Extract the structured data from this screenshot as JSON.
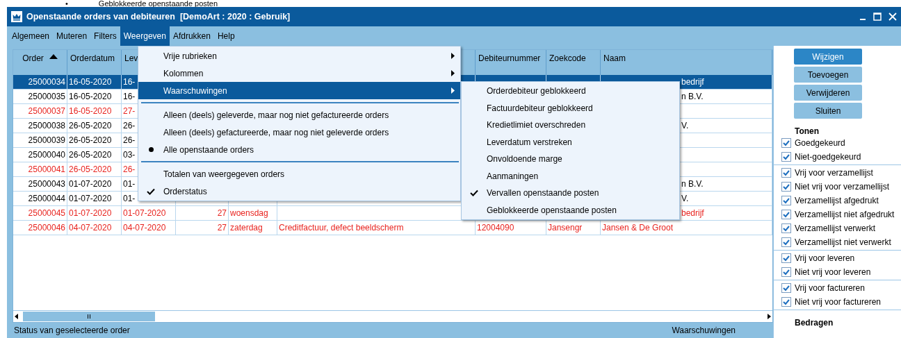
{
  "document_caption": {
    "bullet": "•",
    "text": "Geblokkeerde openstaande posten"
  },
  "window": {
    "title": "Openstaande orders van debiteuren  [DemoArt : 2020 : Gebruik]"
  },
  "menu_bar": [
    {
      "label": "Algemeen",
      "selected": false
    },
    {
      "label": "Muteren",
      "selected": false
    },
    {
      "label": "Filters",
      "selected": false
    },
    {
      "label": "Weergeven",
      "selected": true
    },
    {
      "label": "Afdrukken",
      "selected": false
    },
    {
      "label": "Help",
      "selected": false
    }
  ],
  "table": {
    "columns": {
      "order": {
        "label": "Order",
        "sorted": true
      },
      "orderdatum": {
        "label": "Orderdatum"
      },
      "column_3": {
        "label": "Lev"
      },
      "debiteurnummer": {
        "label": "Debiteurnummer"
      },
      "zoekcode": {
        "label": "Zoekcode"
      },
      "naam": {
        "label": "Naam"
      }
    },
    "rows": [
      {
        "selected": true,
        "warning": false,
        "order": "25000034",
        "orderdatum": "16-05-2020",
        "column_3": "16-",
        "naam": "bedrijf"
      },
      {
        "selected": false,
        "warning": false,
        "order": "25000035",
        "orderdatum": "16-05-2020",
        "column_3": "16-",
        "naam": "n B.V."
      },
      {
        "selected": false,
        "warning": true,
        "order": "25000037",
        "orderdatum": "16-05-2020",
        "column_3": "27-"
      },
      {
        "selected": false,
        "warning": false,
        "order": "25000038",
        "orderdatum": "26-05-2020",
        "column_3": "26-",
        "naam": "V."
      },
      {
        "selected": false,
        "warning": false,
        "order": "25000039",
        "orderdatum": "26-05-2020",
        "column_3": "26-"
      },
      {
        "selected": false,
        "warning": false,
        "order": "25000040",
        "orderdatum": "26-05-2020",
        "column_3": "03-"
      },
      {
        "selected": false,
        "warning": true,
        "order": "25000041",
        "orderdatum": "26-05-2020",
        "column_3": "26-"
      },
      {
        "selected": false,
        "warning": false,
        "order": "25000043",
        "orderdatum": "01-07-2020",
        "column_3": "01-",
        "naam": "n B.V."
      },
      {
        "selected": false,
        "warning": false,
        "order": "25000044",
        "orderdatum": "01-07-2020",
        "column_3": "01-",
        "naam": "V."
      },
      {
        "selected": false,
        "warning": true,
        "order": "25000045",
        "orderdatum": "01-07-2020",
        "column_3": "01-07-2020",
        "column_4": "27",
        "column_5": "woensdag",
        "naam": "bedrijf"
      },
      {
        "selected": false,
        "warning": true,
        "order": "25000046",
        "orderdatum": "04-07-2020",
        "column_3": "04-07-2020",
        "column_4": "27",
        "column_5": "zaterdag",
        "column_6": "Creditfactuur, defect beeldscherm",
        "debiteurnummer": "12004090",
        "zoekcode": "Jansengr",
        "naam": "Jansen & De Groot"
      }
    ]
  },
  "dropdown_menu": {
    "items": [
      {
        "kind": "submenu",
        "label": "Vrije rubrieken",
        "selected": false
      },
      {
        "kind": "submenu",
        "label": "Kolommen",
        "selected": false
      },
      {
        "kind": "submenu",
        "label": "Waarschuwingen",
        "selected": true
      },
      {
        "kind": "separator"
      },
      {
        "kind": "radio",
        "label": "Alleen (deels) geleverde, maar nog niet gefactureerde orders",
        "checked": false
      },
      {
        "kind": "radio",
        "label": "Alleen (deels) gefactureerde, maar nog niet geleverde orders",
        "checked": false
      },
      {
        "kind": "radio",
        "label": "Alle openstaande orders",
        "checked": true
      },
      {
        "kind": "separator"
      },
      {
        "kind": "check",
        "label": "Totalen van weergegeven orders",
        "checked": false
      },
      {
        "kind": "check",
        "label": "Orderstatus",
        "checked": true
      }
    ]
  },
  "submenu": {
    "items": [
      {
        "label": "Orderdebiteur geblokkeerd",
        "checked": false
      },
      {
        "label": "Factuurdebiteur geblokkeerd",
        "checked": false
      },
      {
        "label": "Kredietlimiet overschreden",
        "checked": false
      },
      {
        "label": "Leverdatum verstreken",
        "checked": false
      },
      {
        "label": "Onvoldoende marge",
        "checked": false
      },
      {
        "label": "Aanmaningen",
        "checked": false
      },
      {
        "label": "Vervallen openstaande posten",
        "checked": true
      },
      {
        "label": "Geblokkeerde openstaande posten",
        "checked": false
      }
    ]
  },
  "buttons": [
    {
      "label": "Wijzigen",
      "selected": true
    },
    {
      "label": "Toevoegen",
      "selected": false
    },
    {
      "label": "Verwijderen",
      "selected": false
    },
    {
      "label": "Sluiten",
      "selected": false
    }
  ],
  "filter_groups": [
    {
      "heading": "Tonen",
      "options": [
        {
          "label": "Goedgekeurd",
          "checked": true
        },
        {
          "label": "Niet-goedgekeurd",
          "checked": true
        }
      ]
    },
    {
      "options": [
        {
          "label": "Vrij voor verzamellijst",
          "checked": true
        },
        {
          "label": "Niet vrij voor verzamellijst",
          "checked": true
        },
        {
          "label": "Verzamellijst afgedrukt",
          "checked": true
        },
        {
          "label": "Verzamellijst niet afgedrukt",
          "checked": true
        },
        {
          "label": "Verzamellijst verwerkt",
          "checked": true
        },
        {
          "label": "Verzamellijst niet verwerkt",
          "checked": true
        }
      ]
    },
    {
      "options": [
        {
          "label": "Vrij voor leveren",
          "checked": true
        },
        {
          "label": "Niet vrij voor leveren",
          "checked": true
        }
      ]
    },
    {
      "options": [
        {
          "label": "Vrij voor factureren",
          "checked": true
        },
        {
          "label": "Niet vrij voor factureren",
          "checked": true
        }
      ]
    },
    {
      "heading": "Bedragen"
    }
  ],
  "status_bar": {
    "left": "Status van geselecteerde order",
    "right": "Waarschuwingen"
  }
}
